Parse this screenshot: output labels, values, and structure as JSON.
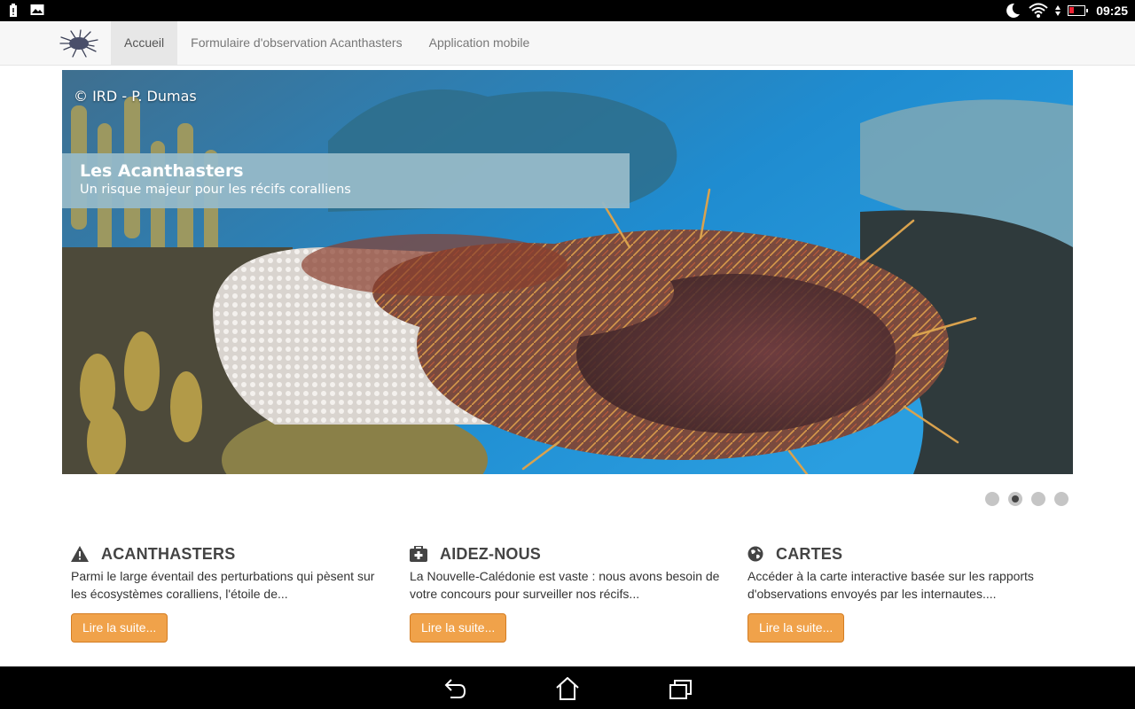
{
  "statusbar": {
    "time": "09:25"
  },
  "navbar": {
    "items": [
      {
        "label": "Accueil"
      },
      {
        "label": "Formulaire d'observation Acanthasters"
      },
      {
        "label": "Application mobile"
      }
    ]
  },
  "carousel": {
    "credit": "© IRD - P. Dumas",
    "caption_title": "Les Acanthasters",
    "caption_subtitle": "Un risque majeur pour les récifs coralliens",
    "slide_count": 4,
    "active_slide": 2
  },
  "features": [
    {
      "title": "ACANTHASTERS",
      "text": "Parmi le large éventail des perturbations qui pèsent sur les écosystèmes coralliens, l'étoile de...",
      "button": "Lire la suite...",
      "icon": "warning-icon"
    },
    {
      "title": "AIDEZ-NOUS",
      "text": "La Nouvelle-Calédonie est vaste : nous avons besoin de votre concours pour surveiller nos récifs...",
      "button": "Lire la suite...",
      "icon": "medkit-icon"
    },
    {
      "title": "CARTES",
      "text": "Accéder à la carte interactive basée sur les rapports d'observations envoyés par les internautes....",
      "button": "Lire la suite...",
      "icon": "globe-icon"
    }
  ],
  "colors": {
    "accent": "#f0a24a",
    "caption_bg": "#96b9c8"
  }
}
